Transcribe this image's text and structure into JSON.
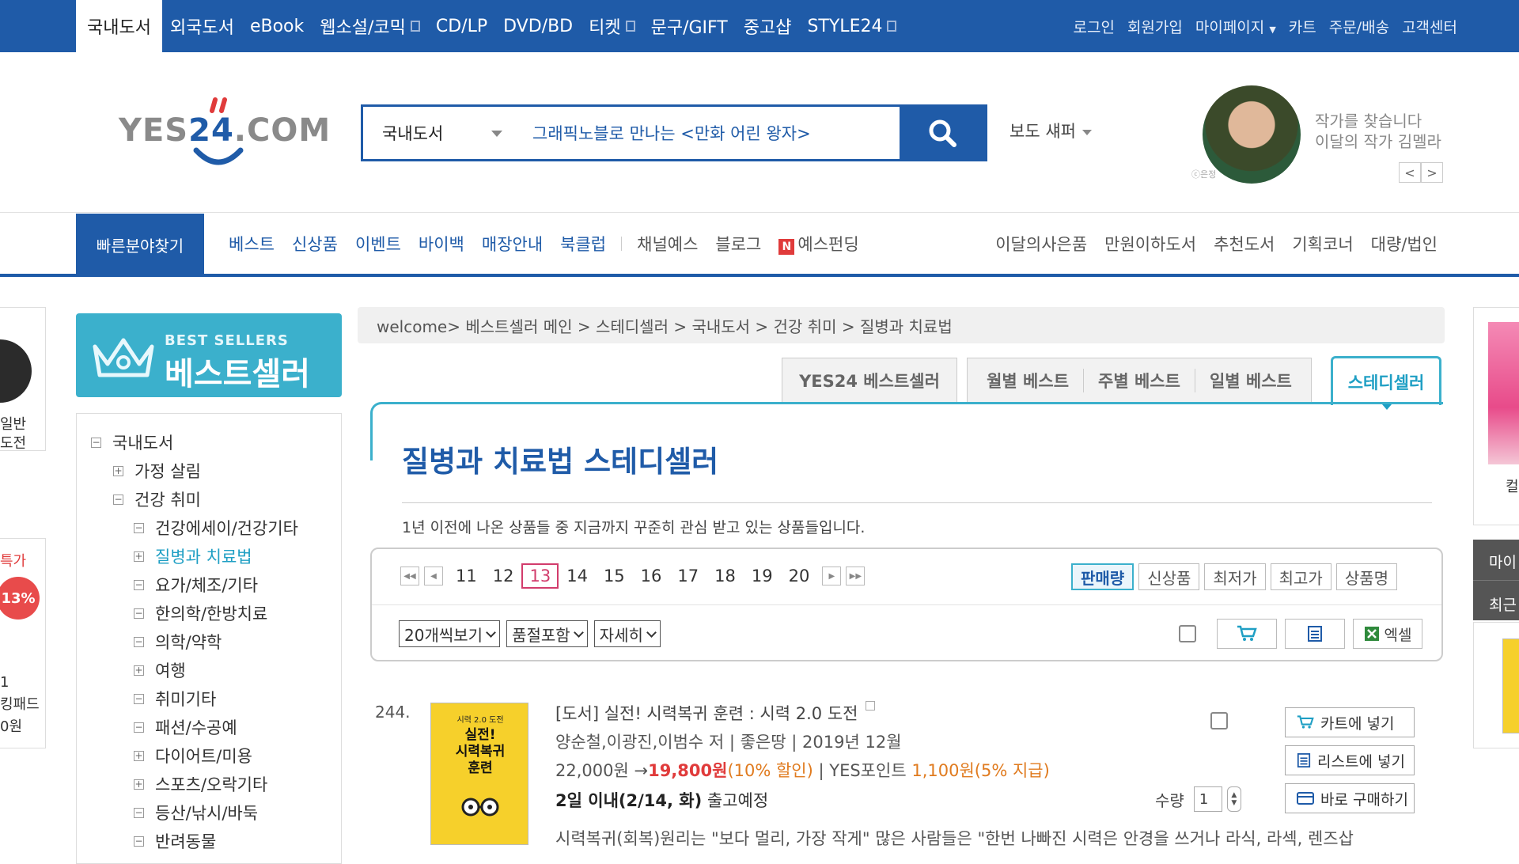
{
  "topnav": {
    "items": [
      "국내도서",
      "외국도서",
      "eBook",
      "웹소설/코믹",
      "CD/LP",
      "DVD/BD",
      "티켓",
      "문구/GIFT",
      "중고샵",
      "STYLE24"
    ],
    "right": [
      "로그인",
      "회원가입",
      "마이페이지",
      "카트",
      "주문/배송",
      "고객센터"
    ]
  },
  "header": {
    "logo": "YES24.COM",
    "search_category": "국내도서",
    "search_query": "그래픽노블로 만나는 <만화 어린 왕자>",
    "bodo_label": "보도 섀퍼",
    "author_credit": "ⓒ은정",
    "author_line1": "작가를 찾습니다",
    "author_line2": "이달의 작가 김멜라",
    "prev": "<",
    "next": ">"
  },
  "catnav": {
    "quick": "빠른분야찾기",
    "links": [
      "베스트",
      "신상품",
      "이벤트",
      "바이백",
      "매장안내",
      "북클럽"
    ],
    "links2": [
      "채널예스",
      "블로그",
      "예스펀딩"
    ],
    "right": [
      "이달의사은품",
      "만원이하도서",
      "추천도서",
      "기획코너",
      "대량/법인"
    ]
  },
  "sidebar": {
    "banner_small": "BEST SELLERS",
    "banner_big": "베스트셀러",
    "tree": [
      {
        "label": "국내도서",
        "level": 0,
        "sign": "−"
      },
      {
        "label": "가정 살림",
        "level": 1,
        "sign": "+"
      },
      {
        "label": "건강 취미",
        "level": 1,
        "sign": "−"
      },
      {
        "label": "건강에세이/건강기타",
        "level": 2,
        "sign": "−"
      },
      {
        "label": "질병과 치료법",
        "level": 2,
        "sign": "+",
        "active": true
      },
      {
        "label": "요가/체조/기타",
        "level": 2,
        "sign": "−"
      },
      {
        "label": "한의학/한방치료",
        "level": 2,
        "sign": "−"
      },
      {
        "label": "의학/약학",
        "level": 2,
        "sign": "−"
      },
      {
        "label": "여행",
        "level": 2,
        "sign": "+"
      },
      {
        "label": "취미기타",
        "level": 2,
        "sign": "−"
      },
      {
        "label": "패션/수공예",
        "level": 2,
        "sign": "−"
      },
      {
        "label": "다이어트/미용",
        "level": 2,
        "sign": "+"
      },
      {
        "label": "스포츠/오락기타",
        "level": 2,
        "sign": "+"
      },
      {
        "label": "등산/낚시/바둑",
        "level": 2,
        "sign": "−"
      },
      {
        "label": "반려동물",
        "level": 2,
        "sign": "−"
      }
    ]
  },
  "breadcrumb": "welcome> 베스트셀러 메인 > 스테디셀러 > 국내도서 > 건강 취미 > 질병과 치료법",
  "tabs": {
    "yes24": "YES24 베스트셀러",
    "group": [
      "월별 베스트",
      "주별 베스트",
      "일별 베스트"
    ],
    "steady": "스테디셀러"
  },
  "main": {
    "title": "질병과 치료법 스테디셀러",
    "desc": "1년 이전에 나온 상품들 중 지금까지 꾸준히 관심 받고 있는 상품들입니다."
  },
  "pager": {
    "pages": [
      "11",
      "12",
      "13",
      "14",
      "15",
      "16",
      "17",
      "18",
      "19",
      "20"
    ],
    "current": "13",
    "sorts": [
      "판매량",
      "신상품",
      "최저가",
      "최고가",
      "상품명"
    ]
  },
  "controls": {
    "selects": [
      "20개씩보기",
      "품절포함",
      "자세히"
    ],
    "excel": "엑셀"
  },
  "product": {
    "rank": "244.",
    "cover_top": "시력 2.0 도전",
    "cover_title": "실전!\n시력복귀\n훈련",
    "title": "[도서] 실전! 시력복귀 훈련 : 시력 2.0 도전",
    "meta": "양순철,이광진,이범수 저 | 좋은땅 | 2019년 12월",
    "price_orig": "22,000원 →",
    "price_sale": "19,800원",
    "price_disc": "(10% 할인)",
    "points_label": " | YES포인트 ",
    "points": "1,100원",
    "points_pct": "(5% 지급)",
    "ship_bold": "2일 이내(2/14, 화)",
    "ship_rest": " 출고예정",
    "desc": "시력복귀(회복)원리는 \"보다 멀리, 가장 작게\" 많은 사람들은 \"한번 나빠진 시력은 안경을 쓰거나 라식, 라섹, 렌즈삽",
    "qty_label": "수량",
    "qty_value": "1",
    "btn_cart": "카트에 넣기",
    "btn_list": "리스트에 넣기",
    "btn_buy": "바로 구매하기"
  },
  "leftads": {
    "t1": "일반\n도전",
    "t2": "특가",
    "badge": "13%",
    "t3": "1\n킹패드\n0원"
  },
  "rightads": {
    "t": "컬",
    "dark1": "마이",
    "dark2": "최근"
  },
  "colors": {
    "brand": "#1f5ba8",
    "accent": "#3bb0cc",
    "sale": "#e03b3b",
    "current_page": "#d23c6c"
  }
}
